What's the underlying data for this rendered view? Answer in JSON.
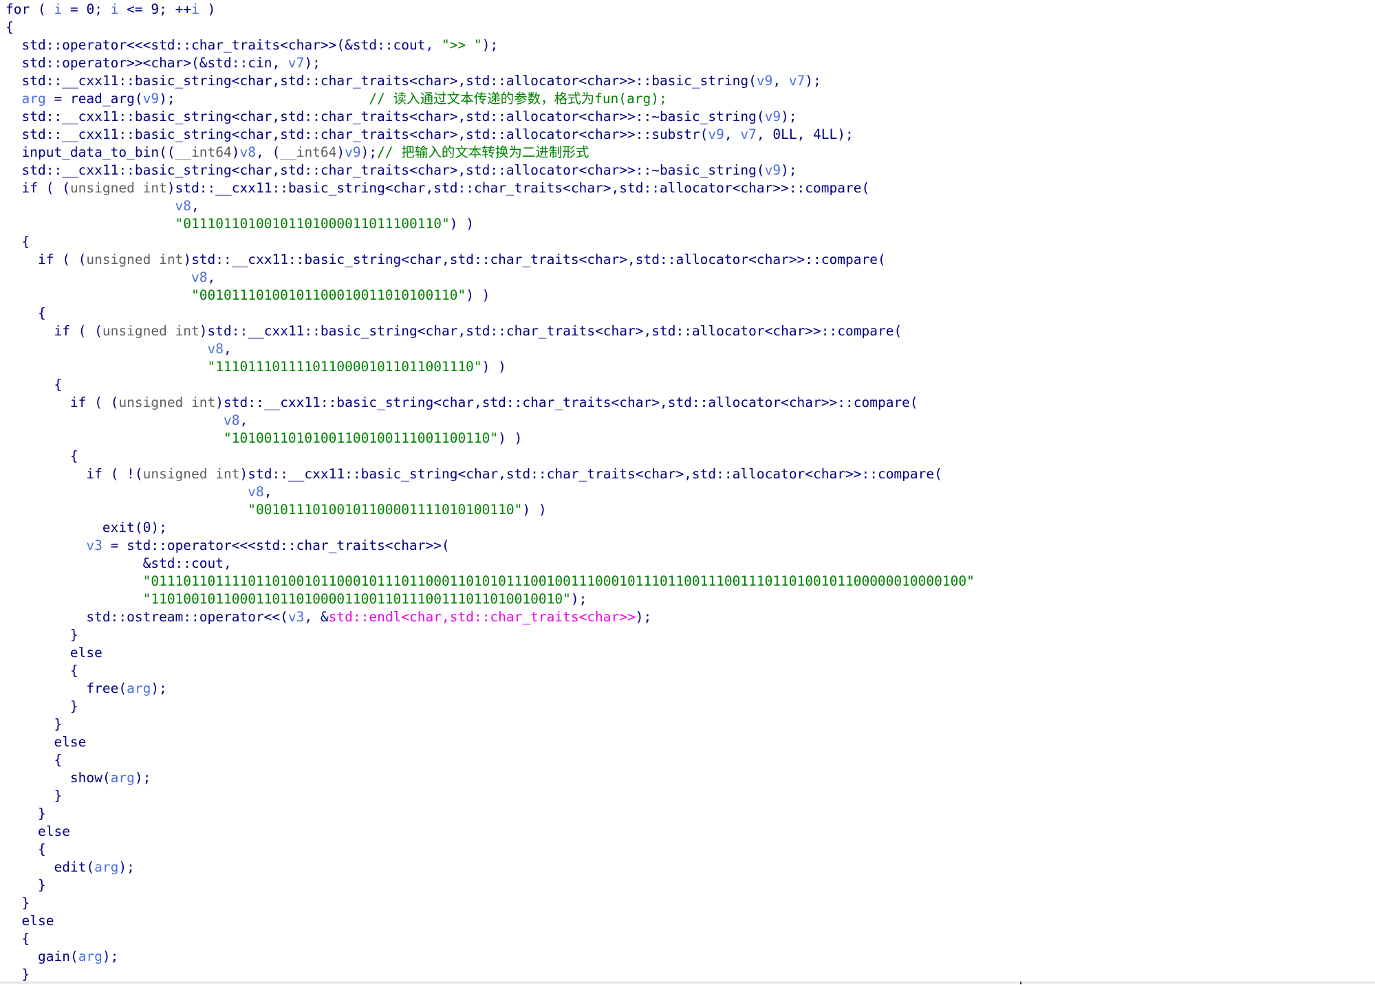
{
  "app": "pseudocode-view",
  "colors": {
    "background": "#ffffff",
    "keyword": "#000080",
    "identifier": "#000080",
    "variable": "#4a6ee0",
    "string": "#008000",
    "comment": "#008000",
    "type": "#606060",
    "import": "#ee00ee"
  },
  "code": {
    "lines": [
      [
        [
          "kw",
          "for"
        ],
        [
          "p",
          " ( "
        ],
        [
          "var",
          "i"
        ],
        [
          "p",
          " = "
        ],
        [
          "num",
          "0"
        ],
        [
          "p",
          "; "
        ],
        [
          "var",
          "i"
        ],
        [
          "p",
          " <= "
        ],
        [
          "num",
          "9"
        ],
        [
          "p",
          "; ++"
        ],
        [
          "var",
          "i"
        ],
        [
          "p",
          " )"
        ]
      ],
      [
        [
          "p",
          "{"
        ]
      ],
      [
        [
          "p",
          "  "
        ],
        [
          "id",
          "std::operator<<<std::char_traits<char>>"
        ],
        [
          "p",
          "(&"
        ],
        [
          "id",
          "std::cout"
        ],
        [
          "p",
          ", "
        ],
        [
          "str",
          "\">> \""
        ],
        [
          "p",
          ");"
        ]
      ],
      [
        [
          "p",
          "  "
        ],
        [
          "id",
          "std::operator>><char>"
        ],
        [
          "p",
          "(&"
        ],
        [
          "id",
          "std::cin"
        ],
        [
          "p",
          ", "
        ],
        [
          "var",
          "v7"
        ],
        [
          "p",
          ");"
        ]
      ],
      [
        [
          "p",
          "  "
        ],
        [
          "id",
          "std::__cxx11::basic_string<char,std::char_traits<char>,std::allocator<char>>::basic_string"
        ],
        [
          "p",
          "("
        ],
        [
          "var",
          "v9"
        ],
        [
          "p",
          ", "
        ],
        [
          "var",
          "v7"
        ],
        [
          "p",
          ");"
        ]
      ],
      [
        [
          "p",
          "  "
        ],
        [
          "var",
          "arg"
        ],
        [
          "p",
          " = "
        ],
        [
          "id",
          "read_arg"
        ],
        [
          "p",
          "("
        ],
        [
          "var",
          "v9"
        ],
        [
          "p",
          ");                        "
        ],
        [
          "cm",
          "// 读入通过文本传递的参数，格式为fun(arg);"
        ]
      ],
      [
        [
          "p",
          "  "
        ],
        [
          "id",
          "std::__cxx11::basic_string<char,std::char_traits<char>,std::allocator<char>>::~basic_string"
        ],
        [
          "p",
          "("
        ],
        [
          "var",
          "v9"
        ],
        [
          "p",
          ");"
        ]
      ],
      [
        [
          "p",
          "  "
        ],
        [
          "id",
          "std::__cxx11::basic_string<char,std::char_traits<char>,std::allocator<char>>::substr"
        ],
        [
          "p",
          "("
        ],
        [
          "var",
          "v9"
        ],
        [
          "p",
          ", "
        ],
        [
          "var",
          "v7"
        ],
        [
          "p",
          ", "
        ],
        [
          "num",
          "0LL"
        ],
        [
          "p",
          ", "
        ],
        [
          "num",
          "4LL"
        ],
        [
          "p",
          ");"
        ]
      ],
      [
        [
          "p",
          "  "
        ],
        [
          "id",
          "input_data_to_bin"
        ],
        [
          "p",
          "(("
        ],
        [
          "ty",
          "__int64"
        ],
        [
          "p",
          ")"
        ],
        [
          "var",
          "v8"
        ],
        [
          "p",
          ", ("
        ],
        [
          "ty",
          "__int64"
        ],
        [
          "p",
          ")"
        ],
        [
          "var",
          "v9"
        ],
        [
          "p",
          ");"
        ],
        [
          "cm",
          "// 把输入的文本转换为二进制形式"
        ]
      ],
      [
        [
          "p",
          "  "
        ],
        [
          "id",
          "std::__cxx11::basic_string<char,std::char_traits<char>,std::allocator<char>>::~basic_string"
        ],
        [
          "p",
          "("
        ],
        [
          "var",
          "v9"
        ],
        [
          "p",
          ");"
        ]
      ],
      [
        [
          "p",
          "  "
        ],
        [
          "kw",
          "if"
        ],
        [
          "p",
          " ( ("
        ],
        [
          "ty",
          "unsigned int"
        ],
        [
          "p",
          ")"
        ],
        [
          "id",
          "std::__cxx11::basic_string<char,std::char_traits<char>,std::allocator<char>>::compare"
        ],
        [
          "p",
          "("
        ]
      ],
      [
        [
          "p",
          "                     "
        ],
        [
          "var",
          "v8"
        ],
        [
          "p",
          ","
        ]
      ],
      [
        [
          "p",
          "                     "
        ],
        [
          "str",
          "\"01110110100101101000011011100110\""
        ],
        [
          "p",
          ") )"
        ]
      ],
      [
        [
          "p",
          "  {"
        ]
      ],
      [
        [
          "p",
          "    "
        ],
        [
          "kw",
          "if"
        ],
        [
          "p",
          " ( ("
        ],
        [
          "ty",
          "unsigned int"
        ],
        [
          "p",
          ")"
        ],
        [
          "id",
          "std::__cxx11::basic_string<char,std::char_traits<char>,std::allocator<char>>::compare"
        ],
        [
          "p",
          "("
        ]
      ],
      [
        [
          "p",
          "                       "
        ],
        [
          "var",
          "v8"
        ],
        [
          "p",
          ","
        ]
      ],
      [
        [
          "p",
          "                       "
        ],
        [
          "str",
          "\"00101110100101100010011010100110\""
        ],
        [
          "p",
          ") )"
        ]
      ],
      [
        [
          "p",
          "    {"
        ]
      ],
      [
        [
          "p",
          "      "
        ],
        [
          "kw",
          "if"
        ],
        [
          "p",
          " ( ("
        ],
        [
          "ty",
          "unsigned int"
        ],
        [
          "p",
          ")"
        ],
        [
          "id",
          "std::__cxx11::basic_string<char,std::char_traits<char>,std::allocator<char>>::compare"
        ],
        [
          "p",
          "("
        ]
      ],
      [
        [
          "p",
          "                         "
        ],
        [
          "var",
          "v8"
        ],
        [
          "p",
          ","
        ]
      ],
      [
        [
          "p",
          "                         "
        ],
        [
          "str",
          "\"11101110111101100001011011001110\""
        ],
        [
          "p",
          ") )"
        ]
      ],
      [
        [
          "p",
          "      {"
        ]
      ],
      [
        [
          "p",
          "        "
        ],
        [
          "kw",
          "if"
        ],
        [
          "p",
          " ( ("
        ],
        [
          "ty",
          "unsigned int"
        ],
        [
          "p",
          ")"
        ],
        [
          "id",
          "std::__cxx11::basic_string<char,std::char_traits<char>,std::allocator<char>>::compare"
        ],
        [
          "p",
          "("
        ]
      ],
      [
        [
          "p",
          "                           "
        ],
        [
          "var",
          "v8"
        ],
        [
          "p",
          ","
        ]
      ],
      [
        [
          "p",
          "                           "
        ],
        [
          "str",
          "\"10100110101001100100111001100110\""
        ],
        [
          "p",
          ") )"
        ]
      ],
      [
        [
          "p",
          "        {"
        ]
      ],
      [
        [
          "p",
          "          "
        ],
        [
          "kw",
          "if"
        ],
        [
          "p",
          " ( !("
        ],
        [
          "ty",
          "unsigned int"
        ],
        [
          "p",
          ")"
        ],
        [
          "id",
          "std::__cxx11::basic_string<char,std::char_traits<char>,std::allocator<char>>::compare"
        ],
        [
          "p",
          "("
        ]
      ],
      [
        [
          "p",
          "                              "
        ],
        [
          "var",
          "v8"
        ],
        [
          "p",
          ","
        ]
      ],
      [
        [
          "p",
          "                              "
        ],
        [
          "str",
          "\"00101110100101100001111010100110\""
        ],
        [
          "p",
          ") )"
        ]
      ],
      [
        [
          "p",
          "            "
        ],
        [
          "id",
          "exit"
        ],
        [
          "p",
          "("
        ],
        [
          "num",
          "0"
        ],
        [
          "p",
          ");"
        ]
      ],
      [
        [
          "p",
          "          "
        ],
        [
          "var",
          "v3"
        ],
        [
          "p",
          " = "
        ],
        [
          "id",
          "std::operator<<<std::char_traits<char>>"
        ],
        [
          "p",
          "("
        ]
      ],
      [
        [
          "p",
          "                 &"
        ],
        [
          "id",
          "std::cout"
        ],
        [
          "p",
          ","
        ]
      ],
      [
        [
          "p",
          "                 "
        ],
        [
          "str",
          "\"0111011011110110100101100010111011000110101011100100111000101110110011100111011010010110000001000010 0\""
        ]
      ],
      [
        [
          "p",
          "                 "
        ],
        [
          "str",
          "\"11010010110001101101000011001101110011101101001001 0\""
        ],
        [
          "p",
          ");"
        ]
      ],
      [
        [
          "p",
          "          "
        ],
        [
          "id",
          "std::ostream::operator<<"
        ],
        [
          "p",
          "("
        ],
        [
          "var",
          "v3"
        ],
        [
          "p",
          ", &"
        ],
        [
          "imp",
          "std::endl<char,std::char_traits<char>>"
        ],
        [
          "p",
          ");"
        ]
      ],
      [
        [
          "p",
          "        }"
        ]
      ],
      [
        [
          "p",
          "        "
        ],
        [
          "kw",
          "else"
        ]
      ],
      [
        [
          "p",
          "        {"
        ]
      ],
      [
        [
          "p",
          "          "
        ],
        [
          "id",
          "free"
        ],
        [
          "p",
          "("
        ],
        [
          "var",
          "arg"
        ],
        [
          "p",
          ");"
        ]
      ],
      [
        [
          "p",
          "        }"
        ]
      ],
      [
        [
          "p",
          "      }"
        ]
      ],
      [
        [
          "p",
          "      "
        ],
        [
          "kw",
          "else"
        ]
      ],
      [
        [
          "p",
          "      {"
        ]
      ],
      [
        [
          "p",
          "        "
        ],
        [
          "id",
          "show"
        ],
        [
          "p",
          "("
        ],
        [
          "var",
          "arg"
        ],
        [
          "p",
          ");"
        ]
      ],
      [
        [
          "p",
          "      }"
        ]
      ],
      [
        [
          "p",
          "    }"
        ]
      ],
      [
        [
          "p",
          "    "
        ],
        [
          "kw",
          "else"
        ]
      ],
      [
        [
          "p",
          "    {"
        ]
      ],
      [
        [
          "p",
          "      "
        ],
        [
          "id",
          "edit"
        ],
        [
          "p",
          "("
        ],
        [
          "var",
          "arg"
        ],
        [
          "p",
          ");"
        ]
      ],
      [
        [
          "p",
          "    }"
        ]
      ],
      [
        [
          "p",
          "  }"
        ]
      ],
      [
        [
          "p",
          "  "
        ],
        [
          "kw",
          "else"
        ]
      ],
      [
        [
          "p",
          "  {"
        ]
      ],
      [
        [
          "p",
          "    "
        ],
        [
          "id",
          "gain"
        ],
        [
          "p",
          "("
        ],
        [
          "var",
          "arg"
        ],
        [
          "p",
          ");"
        ]
      ],
      [
        [
          "p",
          "  }"
        ]
      ]
    ]
  }
}
